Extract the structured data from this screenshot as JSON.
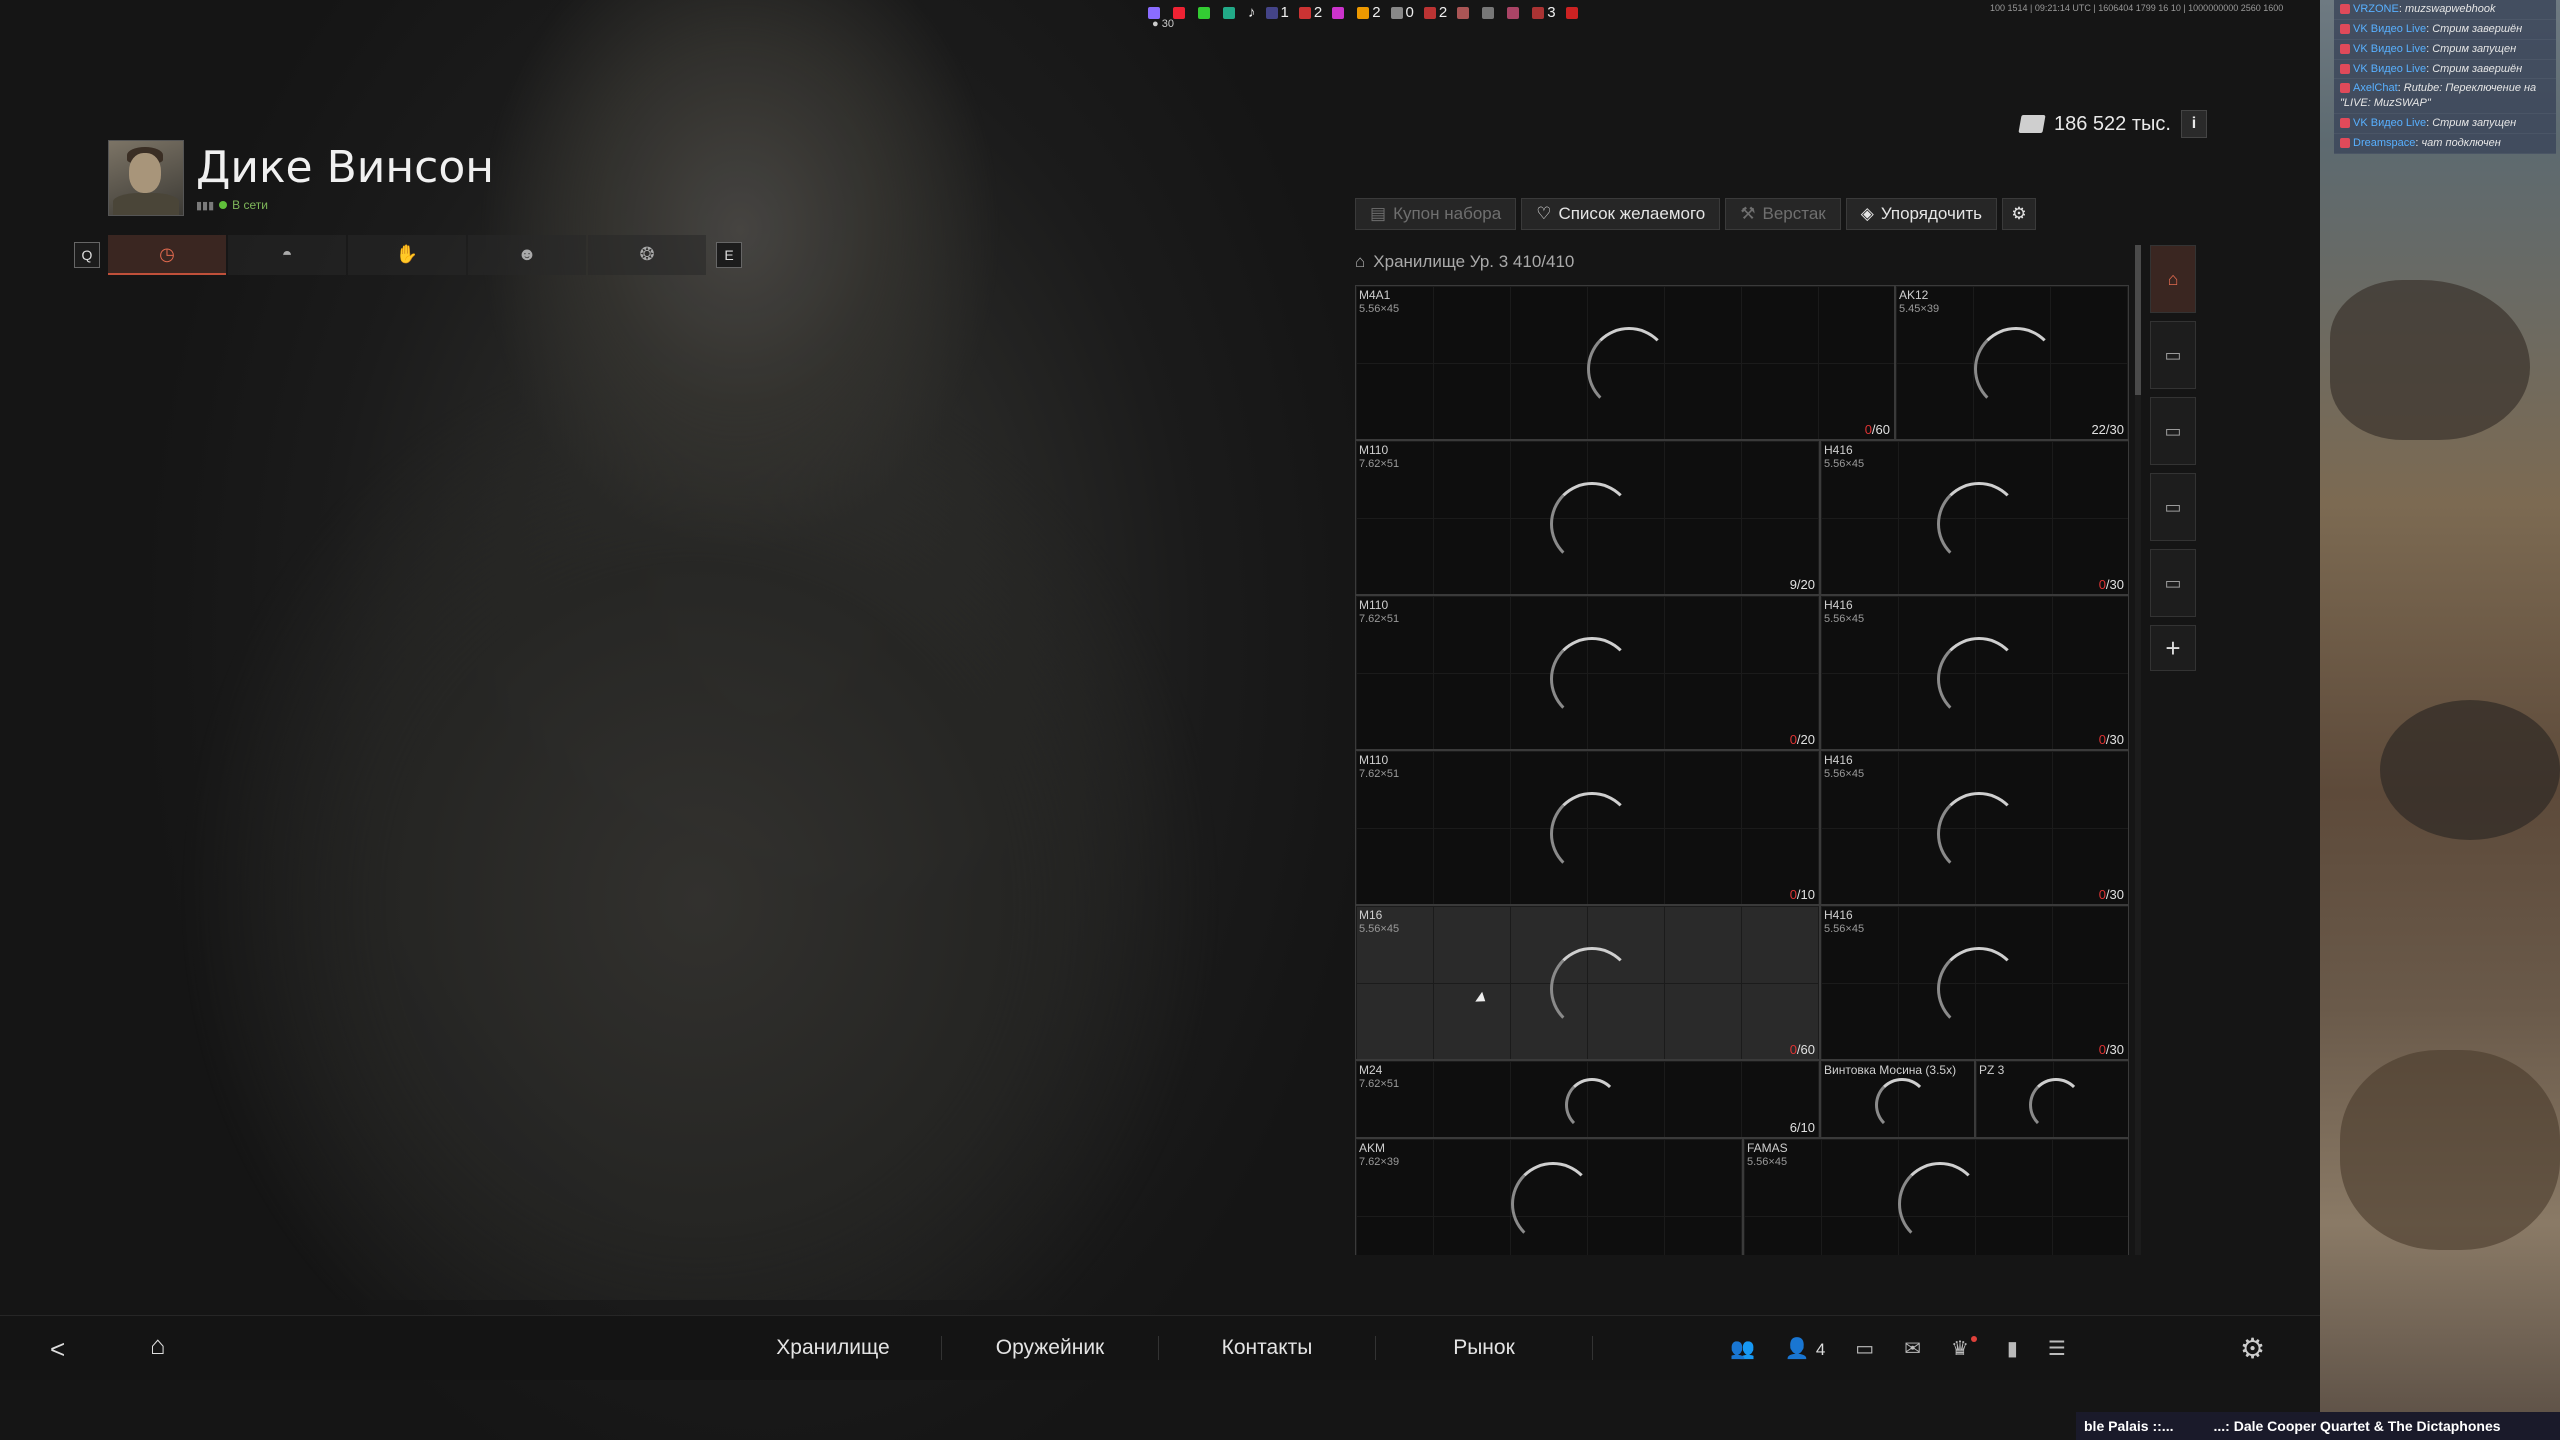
{
  "tray": {
    "items": [
      "1",
      "2",
      "2",
      "0",
      "2",
      "3"
    ],
    "secondary": "30",
    "sysinfo": "100 1514 | 09:21:14 UTC | 1606404 1799 16 10 | 1000000000 2560 1600"
  },
  "profile": {
    "name": "Дике Винсон",
    "status": "В сети",
    "eq_tabs": {
      "left_key": "Q",
      "right_key": "E"
    }
  },
  "balance": {
    "amount": "186 522 тыс.",
    "info_label": "i"
  },
  "toolbar": {
    "coupon": "Купон набора",
    "wishlist": "Список желаемого",
    "workbench": "Верстак",
    "sort": "Упорядочить"
  },
  "stash": {
    "title": "Хранилище Ур. 3 410/410",
    "items": [
      {
        "name": "M4A1",
        "caliber": "5.56×45",
        "count_num": "0",
        "count_den": "/60",
        "zero": true
      },
      {
        "name": "AK12",
        "caliber": "5.45×39",
        "count_num": "22",
        "count_den": "/30",
        "zero": false
      },
      {
        "name": "M110",
        "caliber": "7.62×51",
        "count_num": "9",
        "count_den": "/20",
        "zero": false
      },
      {
        "name": "H416",
        "caliber": "5.56×45",
        "count_num": "0",
        "count_den": "/30",
        "zero": true
      },
      {
        "name": "M110",
        "caliber": "7.62×51",
        "count_num": "0",
        "count_den": "/20",
        "zero": true
      },
      {
        "name": "H416",
        "caliber": "5.56×45",
        "count_num": "0",
        "count_den": "/30",
        "zero": true
      },
      {
        "name": "M110",
        "caliber": "7.62×51",
        "count_num": "0",
        "count_den": "/10",
        "zero": true
      },
      {
        "name": "H416",
        "caliber": "5.56×45",
        "count_num": "0",
        "count_den": "/30",
        "zero": true
      },
      {
        "name": "M16",
        "caliber": "5.56×45",
        "count_num": "0",
        "count_den": "/60",
        "zero": true
      },
      {
        "name": "H416",
        "caliber": "5.56×45",
        "count_num": "0",
        "count_den": "/30",
        "zero": true
      },
      {
        "name": "M24",
        "caliber": "7.62×51",
        "count_num": "6",
        "count_den": "/10",
        "zero": false
      },
      {
        "name": "Винтовка Мосина (3.5x)",
        "caliber": "",
        "count_num": "",
        "count_den": "",
        "zero": false
      },
      {
        "name": "PZ 3",
        "caliber": "",
        "count_num": "",
        "count_den": "",
        "zero": false
      },
      {
        "name": "AKM",
        "caliber": "7.62×39",
        "count_num": "",
        "count_den": "",
        "zero": false
      },
      {
        "name": "FAMAS",
        "caliber": "5.56×45",
        "count_num": "",
        "count_den": "",
        "zero": false
      }
    ]
  },
  "nav": {
    "items": [
      "Хранилище",
      "Оружейник",
      "Контакты",
      "Рынок"
    ],
    "friends_count": "4"
  },
  "chat": {
    "messages": [
      {
        "user": "VRZONE",
        "text": "muzswapwebhook"
      },
      {
        "user": "VK Видео Live",
        "text": "Стрим завершён"
      },
      {
        "user": "VK Видео Live",
        "text": "Стрим запущен"
      },
      {
        "user": "VK Видео Live",
        "text": "Стрим завершён"
      },
      {
        "user": "AxelChat",
        "text": "Rutube: Переключение на \"LIVE: MuzSWAP\""
      },
      {
        "user": "VK Видео Live",
        "text": "Стрим запущен"
      },
      {
        "user": "Dreamspace",
        "text": "чат подключен"
      }
    ]
  },
  "ticker": {
    "left": "ble Palais ::...",
    "right": "...: Dale Cooper Quartet & The Dictaphones"
  },
  "colors": {
    "accent": "#e0694e",
    "zero_count": "#dd3333",
    "online": "#5fbf3a"
  }
}
